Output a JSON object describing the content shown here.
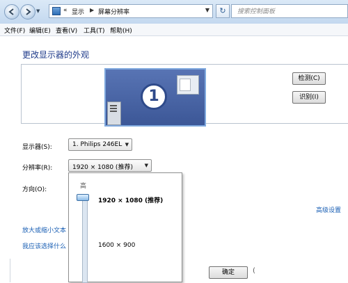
{
  "address_bar": {
    "overflow": "«",
    "crumb_1": "显示",
    "crumb_2": "屏幕分辨率"
  },
  "search": {
    "placeholder": "搜索控制面板"
  },
  "menu": {
    "items": [
      "文件(F)",
      "编辑(E)",
      "查看(V)",
      "工具(T)",
      "帮助(H)"
    ]
  },
  "page": {
    "heading": "更改显示器的外观",
    "monitor_number": "1",
    "detect_button": "检测(C)",
    "identify_button": "识别(I)"
  },
  "settings": {
    "display_label": "显示器(S):",
    "display_value": "1. Philips 246EL",
    "resolution_label": "分辨率(R):",
    "resolution_value": "1920 × 1080 (推荐)",
    "orientation_label": "方向(O):"
  },
  "links": {
    "advanced": "高级设置",
    "text_size": "放大或缩小文本",
    "which_settings": "我应该选择什么"
  },
  "resolution_popup": {
    "high_label": "高",
    "option_top": "1920 × 1080 (推荐)",
    "option_mid": "1600 × 900"
  },
  "footer": {
    "ok_button": "确定"
  },
  "colors": {
    "heading": "#1e3a8a",
    "link": "#1a5fb4",
    "monitor": "#4a64a4"
  }
}
